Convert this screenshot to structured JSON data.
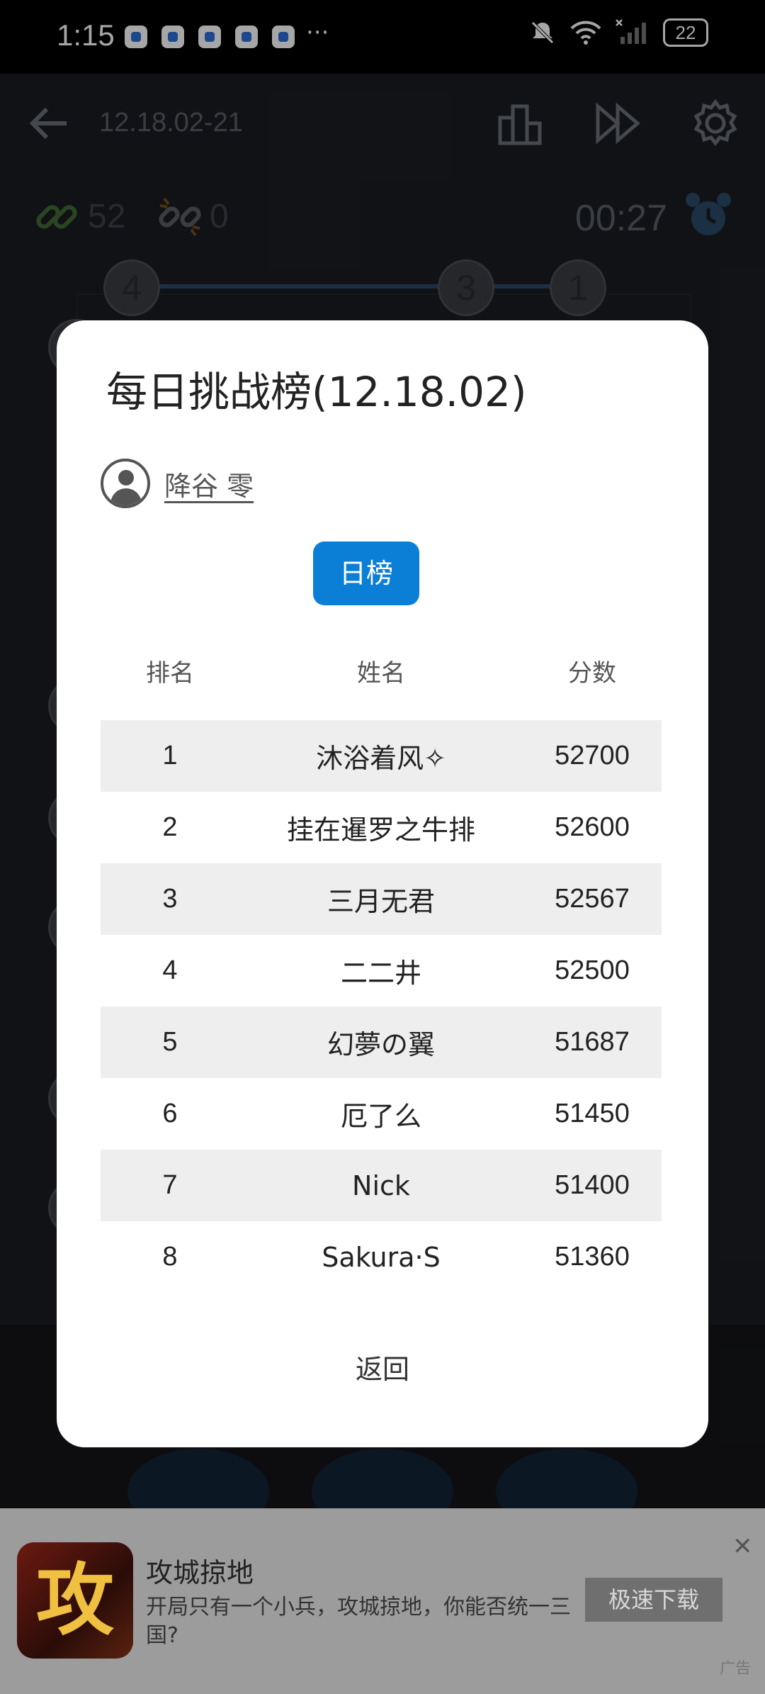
{
  "status_bar": {
    "time": "1:15",
    "more": "···",
    "battery": "22"
  },
  "game": {
    "title": "12.18.02-21",
    "links_count": "52",
    "broken_count": "0",
    "timer": "00:27",
    "nodes": [
      "4",
      "3",
      "1"
    ]
  },
  "dialog": {
    "title": "每日挑战榜(12.18.02)",
    "user_name": "降谷 零",
    "tab_label": "日榜",
    "columns": {
      "rank": "排名",
      "name": "姓名",
      "score": "分数"
    },
    "rows": [
      {
        "rank": "1",
        "name": "沐浴着风✧",
        "score": "52700"
      },
      {
        "rank": "2",
        "name": "挂在暹罗之牛排",
        "score": "52600"
      },
      {
        "rank": "3",
        "name": "三月无君",
        "score": "52567"
      },
      {
        "rank": "4",
        "name": "二二井",
        "score": "52500"
      },
      {
        "rank": "5",
        "name": "幻夢の翼",
        "score": "51687"
      },
      {
        "rank": "6",
        "name": "厄了么",
        "score": "51450"
      },
      {
        "rank": "7",
        "name": "Nick",
        "score": "51400"
      },
      {
        "rank": "8",
        "name": "Sakura·S",
        "score": "51360"
      }
    ],
    "back_label": "返回",
    "accent_color": "#0b7ed6"
  },
  "ad": {
    "icon_char": "攻",
    "title": "攻城掠地",
    "description": "开局只有一个小兵，攻城掠地，你能否统一三国?",
    "button": "极速下载",
    "close": "✕",
    "label": "广告"
  }
}
